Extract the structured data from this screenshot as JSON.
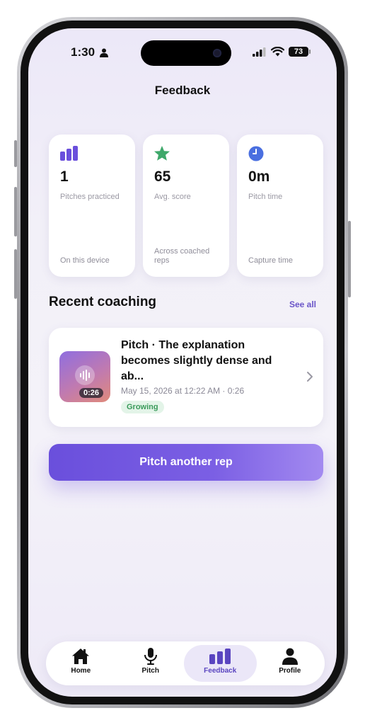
{
  "status_bar": {
    "time": "1:30",
    "battery": "73",
    "icons": [
      "person-icon",
      "signal-icon",
      "wifi-icon",
      "battery-icon"
    ]
  },
  "header": {
    "title": "Feedback"
  },
  "stats": [
    {
      "icon": "bar-chart-icon",
      "icon_color": "#6a4fdc",
      "value": "1",
      "label": "Pitches practiced",
      "footnote": "On this device"
    },
    {
      "icon": "star-icon",
      "icon_color": "#3ea86a",
      "value": "65",
      "label": "Avg. score",
      "footnote": "Across coached reps"
    },
    {
      "icon": "clock-icon",
      "icon_color": "#4a6fe0",
      "value": "0m",
      "label": "Pitch time",
      "footnote": "Capture time"
    }
  ],
  "recent": {
    "title": "Recent coaching",
    "see_all": "See all",
    "items": [
      {
        "title": "Pitch · The explanation becomes slightly dense and ab...",
        "meta": "May 15, 2026 at 12:22 AM · 0:26",
        "duration": "0:26",
        "badge": "Growing"
      }
    ]
  },
  "cta": {
    "label": "Pitch another rep"
  },
  "tabs": [
    {
      "label": "Home",
      "icon": "house-icon",
      "active": false
    },
    {
      "label": "Pitch",
      "icon": "microphone-icon",
      "active": false
    },
    {
      "label": "Feedback",
      "icon": "bar-chart-icon",
      "active": true
    },
    {
      "label": "Profile",
      "icon": "person-icon",
      "active": false
    }
  ],
  "colors": {
    "accent": "#6a4fdc",
    "success": "#3ea86a",
    "background": "#f2f0f8"
  }
}
